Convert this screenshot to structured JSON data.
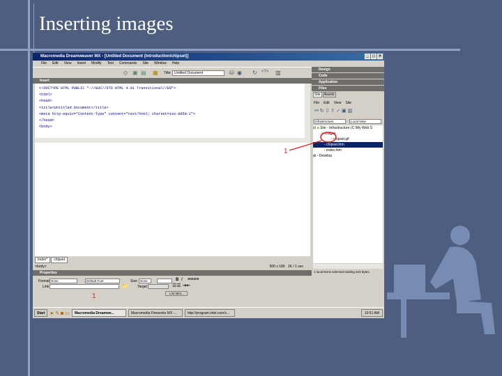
{
  "slide": {
    "title": "Inserting images"
  },
  "window": {
    "title": "Macromedia Dreamweaver MX - [Untitled Document (Introduction/chipset)]"
  },
  "menu": [
    "File",
    "Edit",
    "View",
    "Insert",
    "Modify",
    "Text",
    "Commands",
    "Site",
    "Window",
    "Help"
  ],
  "toolbar": {
    "title_label": "Title:",
    "title_value": "Untitled Document"
  },
  "insert_panel": "Insert",
  "code_lines": [
    "<!DOCTYPE HTML PUBLIC \"-//W3C//DTD HTML 4.01 Transitional//EN\">",
    "<html>",
    "<head>",
    "<title>Untitled Document</title>",
    "<meta http-equiv=\"Content-Type\" content=\"text/html; charset=iso-8859-1\">",
    "</head>",
    "",
    "<body>"
  ],
  "doc_tabs": [
    "Index*",
    "chipset"
  ],
  "status": {
    "tag": "<body>",
    "size": "500 x 189",
    "weight": "1K / 1 sec"
  },
  "properties": {
    "header": "Properties",
    "format_label": "Format",
    "format_value": "None",
    "font_value": "Default Font",
    "size_label": "Size",
    "size_value": "None",
    "link_label": "Link",
    "target_label": "Target",
    "list_item": "List Item..."
  },
  "annotation": "1",
  "right_panels": [
    "Design",
    "Code",
    "Application",
    "Files"
  ],
  "files": {
    "tabs": [
      "Site",
      "Assets"
    ],
    "menu": [
      "File",
      "Edit",
      "View",
      "Site"
    ],
    "site_select": "Infrastructure",
    "view_select": "Local View",
    "tree": [
      "Site - Infrastructure (C:\\My Web S",
      "images",
      "chipset.gif",
      "chipset.htm",
      "index.htm",
      "Desktop"
    ],
    "status": "1 local items selected totaling 223 bytes."
  },
  "taskbar": {
    "start": "Start",
    "tasks": [
      "Macromedia Dreamwe...",
      "Macromedia Fireworks MX -...",
      "http://program.intel.com/c..."
    ],
    "clock": "10:51 AM"
  }
}
